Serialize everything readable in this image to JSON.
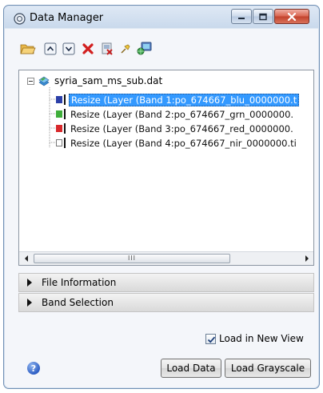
{
  "window": {
    "title": "Data Manager"
  },
  "toolbar": {
    "buttons": [
      {
        "icon": "open-folder-icon"
      },
      {
        "icon": "move-up-icon"
      },
      {
        "icon": "move-down-icon"
      },
      {
        "icon": "delete-icon"
      },
      {
        "icon": "close-file-icon"
      },
      {
        "icon": "pin-icon"
      },
      {
        "icon": "network-icon"
      }
    ]
  },
  "tree": {
    "root": {
      "label": "syria_sam_ms_sub.dat"
    },
    "bands": [
      {
        "label": "Resize (Layer (Band 1:po_674667_blu_0000000.t",
        "color": "#2b3fa8",
        "selected": true
      },
      {
        "label": "Resize (Layer (Band 2:po_674667_grn_0000000.",
        "color": "#3fae3a",
        "selected": false
      },
      {
        "label": "Resize (Layer (Band 3:po_674667_red_0000000.",
        "color": "#d8282b",
        "selected": false
      },
      {
        "label": "Resize (Layer (Band 4:po_674667_nir_0000000.ti",
        "color": "#ffffff",
        "selected": false
      }
    ],
    "scrollbar_grip": "III"
  },
  "sections": {
    "file_info": {
      "label": "File Information"
    },
    "band_selection": {
      "label": "Band Selection"
    }
  },
  "options": {
    "load_new_view": {
      "label": "Load in New View",
      "checked": true
    }
  },
  "actions": {
    "load_data": "Load Data",
    "load_grayscale": "Load Grayscale"
  },
  "help": {
    "glyph": "?"
  },
  "colors": {
    "selection": "#3399ff",
    "title_bar": "#c9d9ec",
    "close_button": "#c2412b"
  }
}
